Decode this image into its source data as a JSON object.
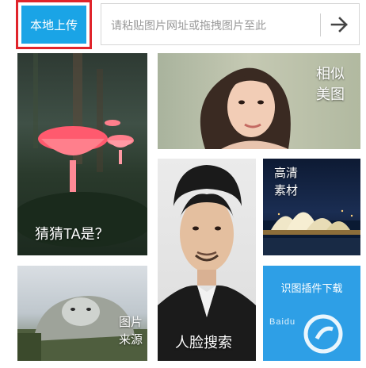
{
  "toolbar": {
    "upload_label": "本地上传",
    "url_placeholder": "请粘贴图片网址或拖拽图片至此",
    "go_icon": "arrow-right-icon"
  },
  "tiles": {
    "guess": {
      "label": "猜猜TA是？"
    },
    "similar": {
      "line1": "相似",
      "line2": "美图"
    },
    "face": {
      "label": "人脸搜索"
    },
    "hd": {
      "line1": "高清",
      "line2": "素材"
    },
    "source": {
      "line1": "图片",
      "line2": "来源"
    },
    "plugin": {
      "label": "识图插件下载"
    }
  },
  "watermark": {
    "text": "Baidu"
  },
  "colors": {
    "accent": "#1aa4e6",
    "highlight_border": "#e0242b",
    "plugin_tile": "#2e9fe6"
  }
}
